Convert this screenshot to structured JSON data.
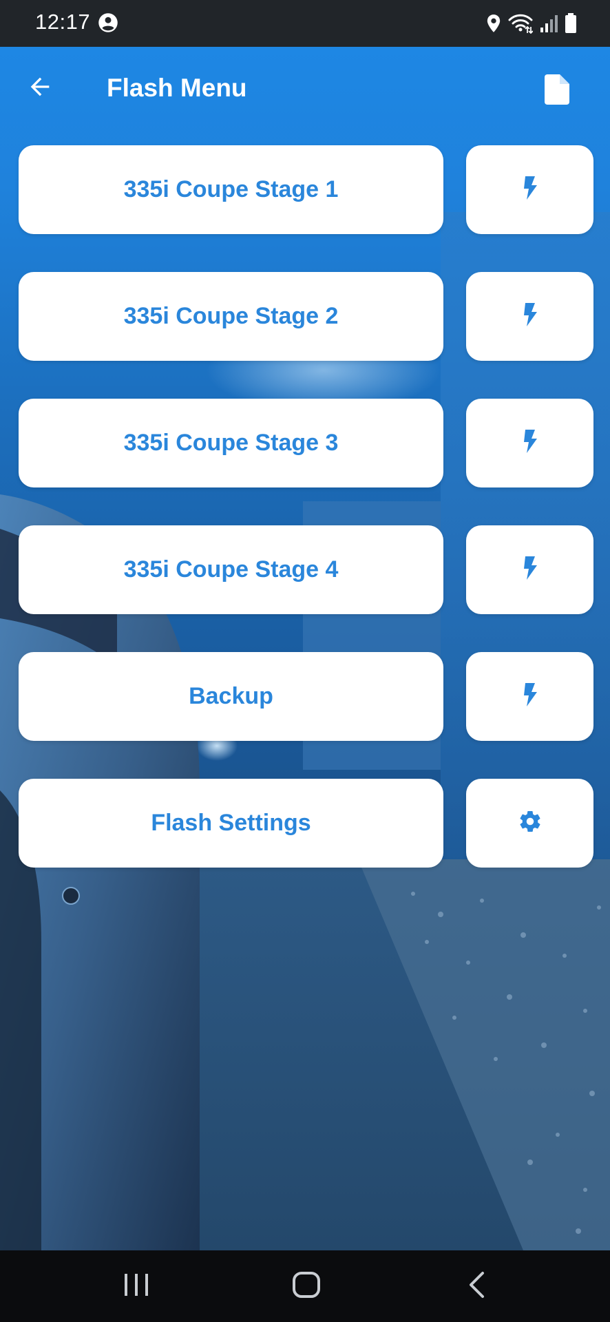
{
  "status_bar": {
    "time": "12:17",
    "icons": [
      "account-circle-icon",
      "location-icon",
      "wifi-icon",
      "signal-icon",
      "battery-icon"
    ]
  },
  "app_bar": {
    "title": "Flash Menu",
    "back_icon": "arrow-left-icon",
    "action_icon": "document-icon"
  },
  "menu": {
    "items": [
      {
        "label": "335i Coupe Stage 1",
        "action_icon": "flash-icon"
      },
      {
        "label": "335i Coupe Stage 2",
        "action_icon": "flash-icon"
      },
      {
        "label": "335i Coupe Stage 3",
        "action_icon": "flash-icon"
      },
      {
        "label": "335i Coupe Stage 4",
        "action_icon": "flash-icon"
      },
      {
        "label": "Backup",
        "action_icon": "flash-icon"
      },
      {
        "label": "Flash Settings",
        "action_icon": "gear-icon"
      }
    ]
  },
  "nav_bar": {
    "icons": [
      "recents-icon",
      "home-icon",
      "back-icon"
    ]
  },
  "colors": {
    "accent": "#2a86db",
    "app_bar": "#1e87e4",
    "status_bar": "#212529",
    "nav_bar": "#0b0c0e",
    "button_bg": "#ffffff"
  }
}
